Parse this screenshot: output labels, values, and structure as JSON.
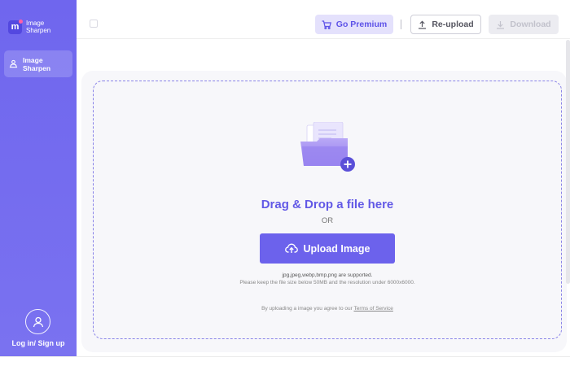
{
  "brand": {
    "line1": "Image",
    "line2": "Sharpen"
  },
  "sidebar": {
    "items": [
      {
        "line1": "Image",
        "line2": "Sharpen",
        "icon": "image-sharpen-icon"
      }
    ],
    "login_label": "Log in/ Sign up"
  },
  "toolbar": {
    "premium_label": "Go Premium",
    "reupload_label": "Re-upload",
    "download_label": "Download"
  },
  "upload": {
    "title": "Drag & Drop a file here",
    "or": "OR",
    "button_label": "Upload Image",
    "formats": "jpg,jpeg,webp,bmp,png are supported.",
    "limits": "Please keep the file size below 50MB and the resolution under 6000x6000.",
    "terms_prefix": "By uploading a image you agree to our ",
    "terms_link": "Terms of Service"
  },
  "colors": {
    "accent": "#6c62ec",
    "sidebar": "#6f66ee",
    "premium_bg": "#e4e1fc"
  }
}
